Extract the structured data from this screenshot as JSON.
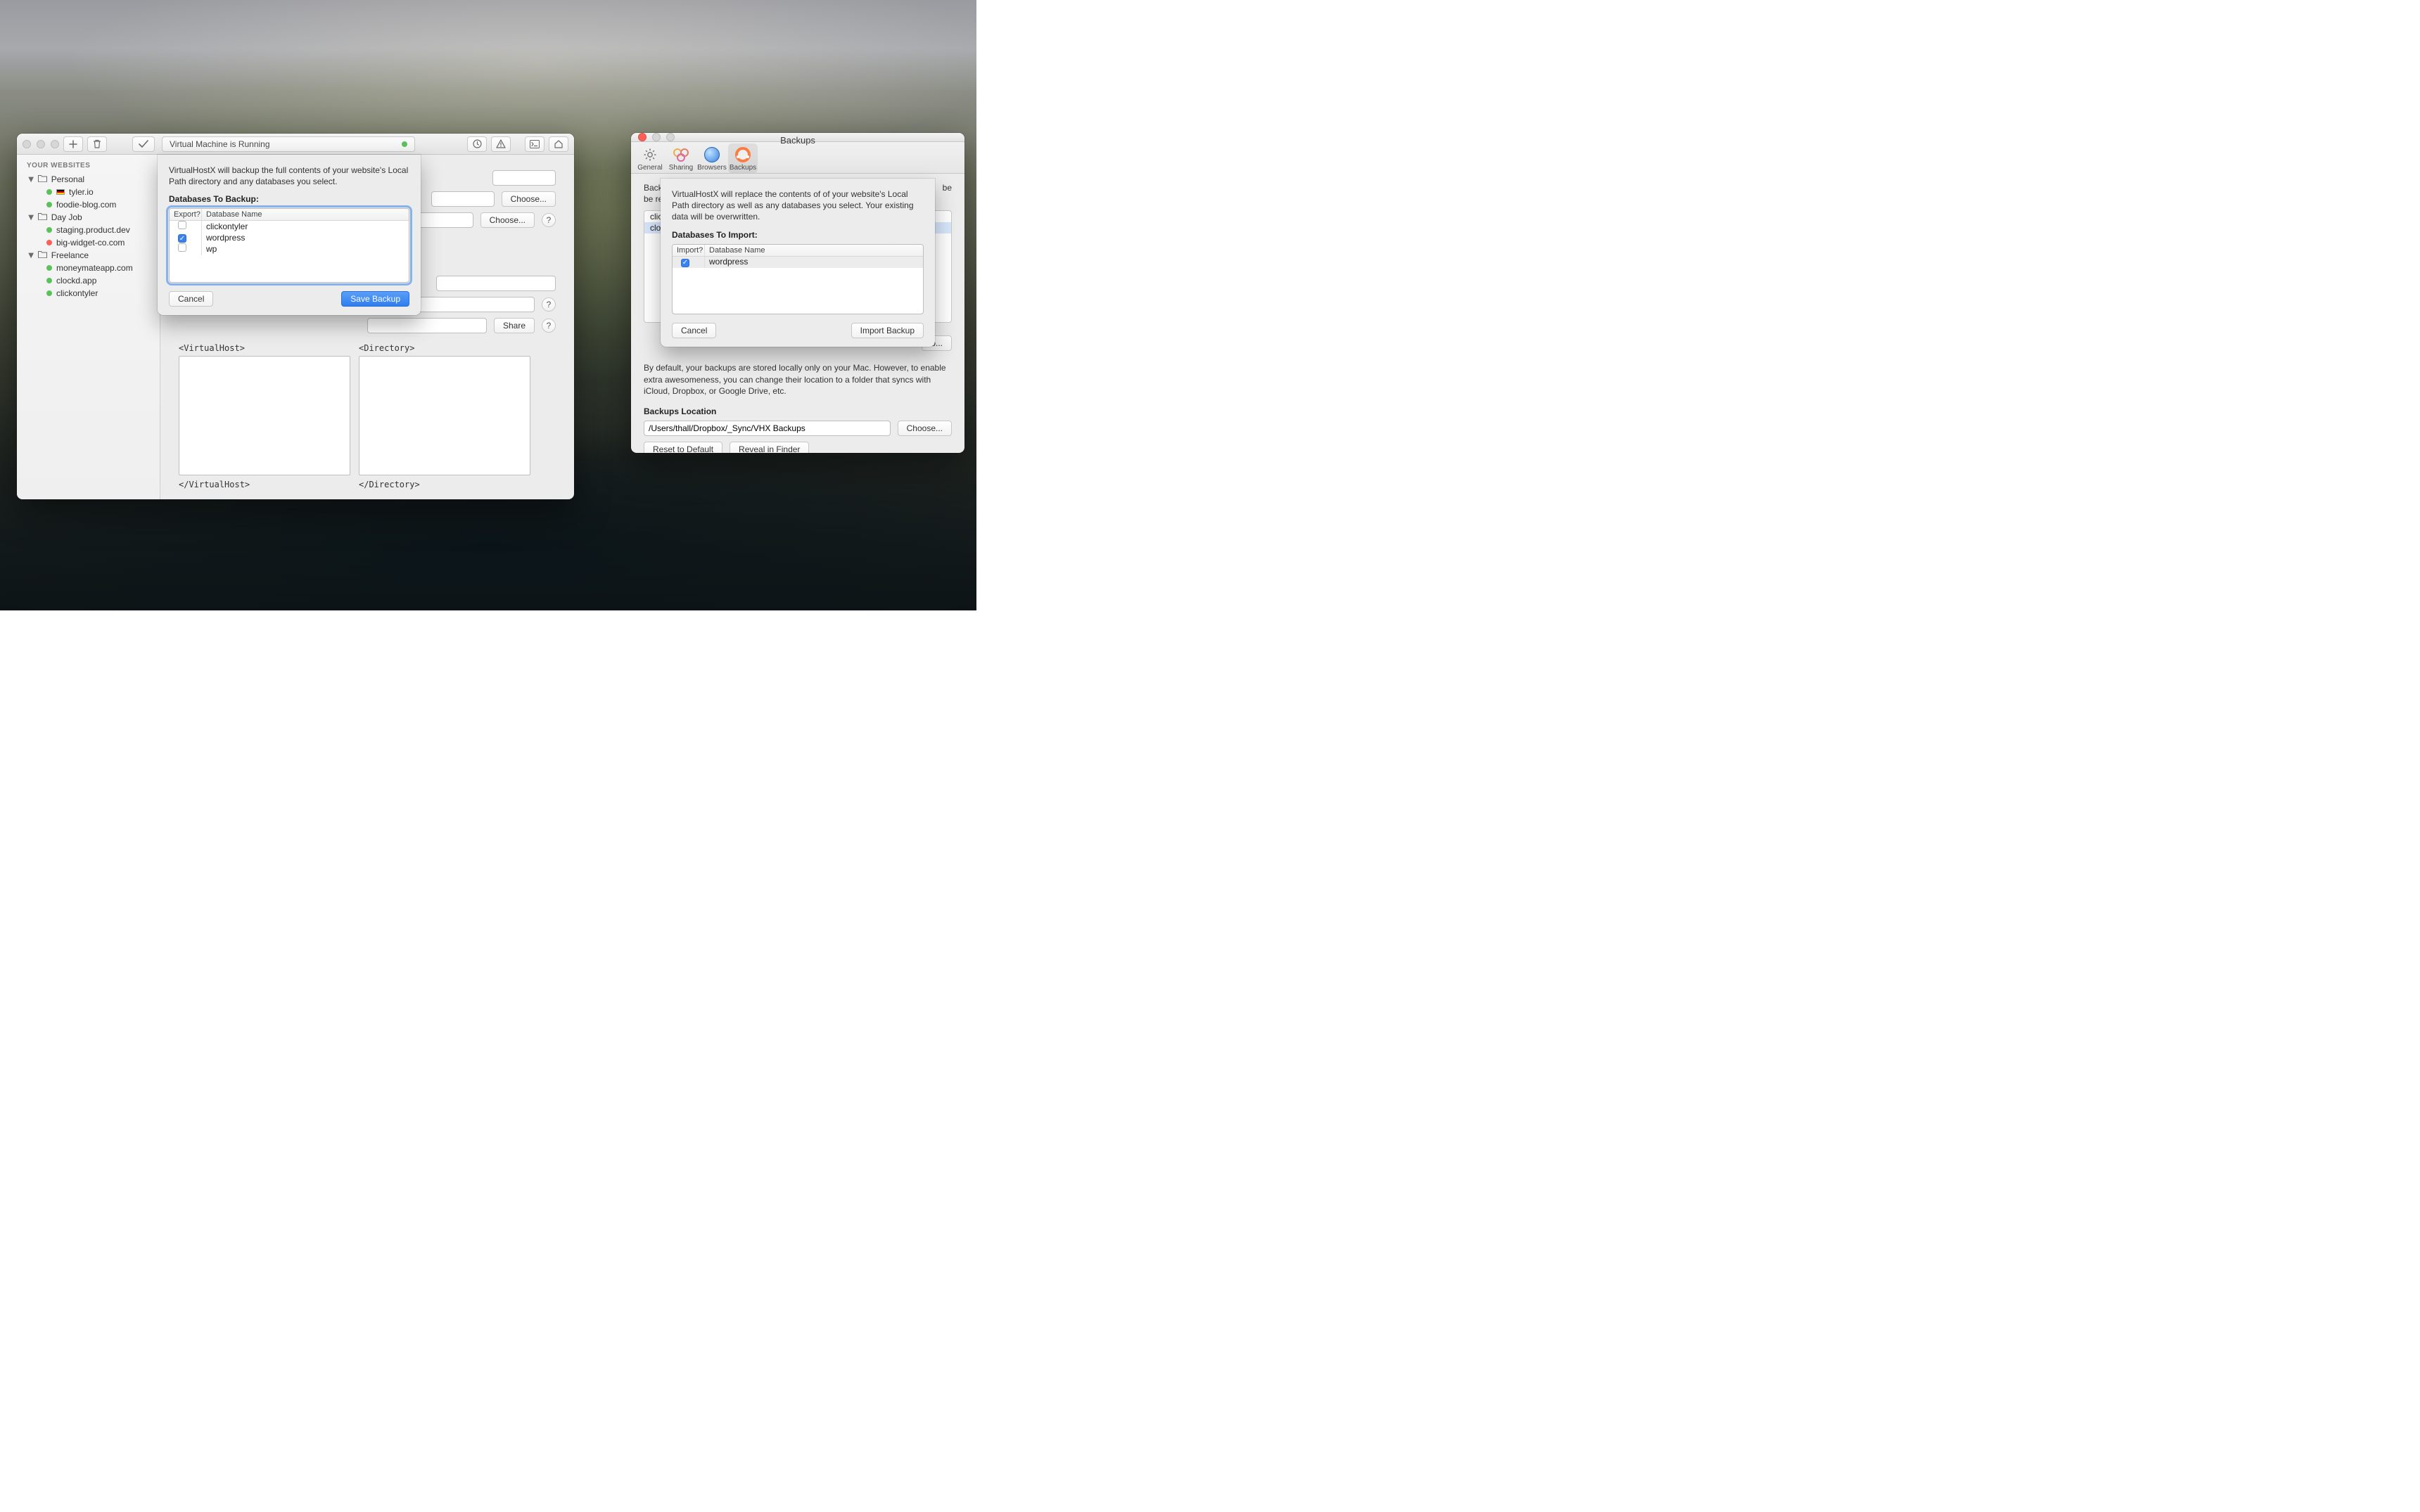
{
  "main_window": {
    "status": "Virtual Machine is Running",
    "toolbar_icons": {
      "add": "+",
      "trash": "trash",
      "check": "✓",
      "clock": "clock",
      "warn": "⚠",
      "terminal": ">_",
      "home": "⌂"
    },
    "sidebar": {
      "header": "YOUR WEBSITES",
      "groups": [
        {
          "name": "Personal",
          "sites": [
            {
              "name": "tyler.io",
              "status": "green",
              "flag": true
            },
            {
              "name": "foodie-blog.com",
              "status": "green"
            }
          ]
        },
        {
          "name": "Day Job",
          "sites": [
            {
              "name": "staging.product.dev",
              "status": "green"
            },
            {
              "name": "big-widget-co.com",
              "status": "red"
            }
          ]
        },
        {
          "name": "Freelance",
          "sites": [
            {
              "name": "moneymateapp.com",
              "status": "green"
            },
            {
              "name": "clockd.app",
              "status": "green"
            },
            {
              "name": "clickontyler",
              "status": "green"
            }
          ]
        }
      ]
    },
    "detail": {
      "choose_label": "Choose...",
      "share_label": "Share",
      "vhost_open": "<VirtualHost>",
      "vhost_close": "</VirtualHost>",
      "dir_open": "<Directory>",
      "dir_close": "</Directory>"
    },
    "backup_sheet": {
      "intro": "VirtualHostX will backup the full contents of your website's Local Path directory and any databases you select.",
      "section_label": "Databases To Backup:",
      "col_export": "Export?",
      "col_dbname": "Database Name",
      "rows": [
        {
          "name": "clickontyler",
          "checked": false
        },
        {
          "name": "wordpress",
          "checked": true
        },
        {
          "name": "wp",
          "checked": false
        }
      ],
      "cancel": "Cancel",
      "save": "Save Backup"
    }
  },
  "prefs_window": {
    "title": "Backups",
    "tabs": {
      "general": "General",
      "sharing": "Sharing",
      "browsers": "Browsers",
      "backups": "Backups"
    },
    "intro_partial_left": "Back",
    "intro_partial_right": " be resto",
    "list_rows": [
      "click",
      "clock"
    ],
    "right_truncated_label": "o...",
    "footer_text": "By default, your backups are stored locally only on your Mac. However, to enable extra awesomeness, you can change their location to a folder that syncs with iCloud, Dropbox, or Google Drive, etc.",
    "location_label": "Backups Location",
    "location_value": "/Users/thall/Dropbox/_Sync/VHX Backups",
    "choose": "Choose...",
    "reset": "Reset to Default",
    "reveal": "Reveal in Finder",
    "import_sheet": {
      "intro": "VirtualHostX will replace the contents of of your website's Local Path directory as well as any databases you select. Your existing data will be overwritten.",
      "section_label": "Databases To Import:",
      "col_import": "Import?",
      "col_dbname": "Database Name",
      "rows": [
        {
          "name": "wordpress",
          "checked": true
        }
      ],
      "cancel": "Cancel",
      "importBtn": "Import Backup"
    }
  }
}
